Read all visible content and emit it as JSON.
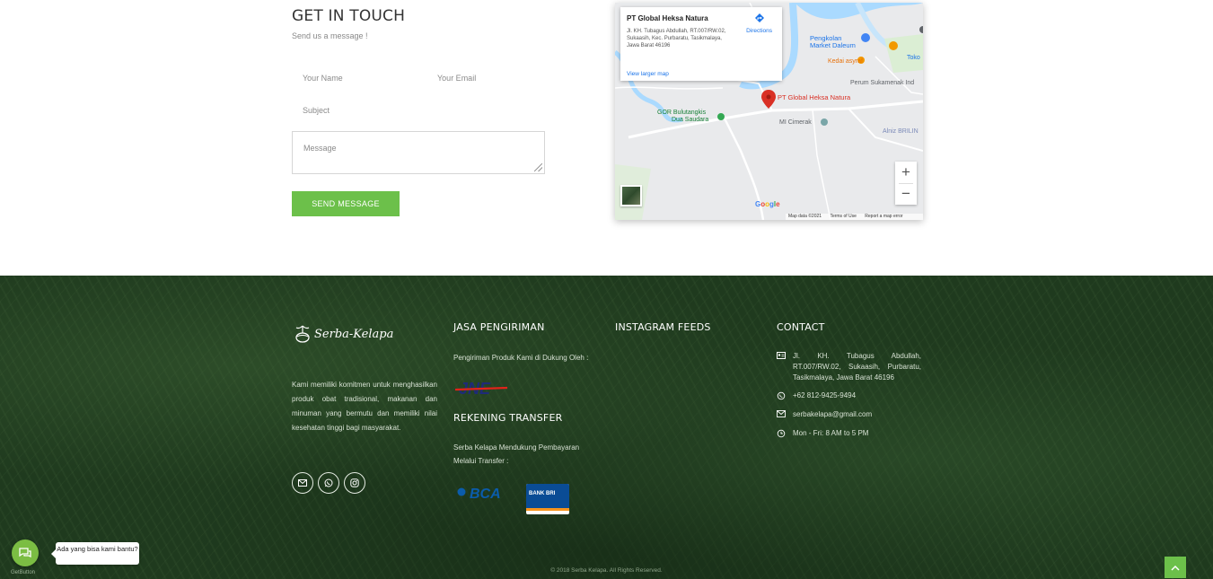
{
  "contact_form": {
    "title": "GET IN TOUCH",
    "subtitle": "Send us a message !",
    "name_placeholder": "Your Name",
    "email_placeholder": "Your Email",
    "subject_placeholder": "Subject",
    "message_placeholder": "Message",
    "send_label": "SEND MESSAGE"
  },
  "map": {
    "place_name": "PT Global Heksa Natura",
    "address": "Jl. KH. Tubagus Abdullah, RT.007/RW.02, Sukaasih, Kec. Purbaratu, Tasikmalaya, Jawa Barat 46196",
    "directions_label": "Directions",
    "larger_map_label": "View larger map",
    "pin_label": "PT Global Heksa Natura",
    "labels": {
      "pengkolan": "Pengkolan",
      "market": "Market Daleum",
      "kedai": "Kedai asyraf",
      "toko": "Toko",
      "perum": "Perum Sukamenak Ind",
      "gor1": "GOR Bulutangkis",
      "gor2": "Dua Saudara",
      "mi": "MI Cimerak",
      "alniz": "Alniz BRILIN"
    },
    "zoom_in": "+",
    "zoom_out": "−",
    "google": "Google",
    "map_data": "Map data ©2021",
    "terms": "Terms of Use",
    "report": "Report a map error"
  },
  "footer": {
    "logo_text": "Serba-Kelapa",
    "about": "Kami memiliki komitmen untuk menghasilkan produk obat tradisional, makanan dan minuman yang bermutu dan memiliki nilai kesehatan tinggi bagi masyarakat.",
    "shipping_title": "JASA PENGIRIMAN",
    "shipping_text": "Pengiriman Produk Kami di Dukung Oleh :",
    "jne_label": "JNE",
    "transfer_title": "REKENING TRANSFER",
    "transfer_text": "Serba Kelapa Mendukung Pembayaran Melalui Transfer :",
    "bca_label": "BCA",
    "bri_label": "BANK BRI",
    "instagram_title": "INSTAGRAM FEEDS",
    "contact_title": "CONTACT",
    "address": "Jl. KH. Tubagus Abdullah, RT.007/RW.02, Sukaasih, Purbaratu, Tasikmalaya, Jawa Barat 46196",
    "phone": "+62 812-9425-9494",
    "email": "serbakelapa@gmail.com",
    "hours": "Mon - Fri: 8 AM to 5 PM",
    "copyright": "© 2018 Serba Kelapa. All Rights Reserved."
  },
  "chat": {
    "bubble_text": "Ada yang bisa kami bantu?",
    "widget_label": "GetButton"
  },
  "colors": {
    "accent_green": "#6cc04a",
    "footer_bg": "#1f3a1e",
    "map_pin": "#d93025",
    "link_blue": "#1a73e8"
  }
}
